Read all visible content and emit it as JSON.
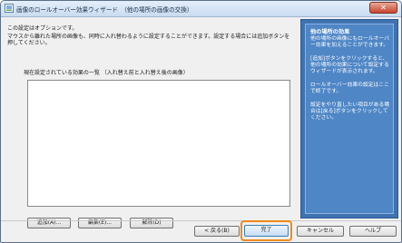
{
  "window": {
    "title": "画像のロールオーバー効果ウィザード　（他の場所の画像の交換）",
    "close_label": "✕"
  },
  "main": {
    "optional_note": "この設定はオプションです。",
    "description": "マウスから離れた場所の画像も、同時に入れ替わるように設定することができます。設定する場合には追加ボタンを押してください。",
    "list_label": "現在設定されている効果の一覧 （入れ替え前と入れ替え後の画像）",
    "effect_list_items": [],
    "add_button": "追加(A)...",
    "edit_button": "編集(E)...",
    "delete_button": "解除(D)"
  },
  "side_panel": {
    "heading": "他の場所の効果",
    "p1": "他の場所の画像にもロールオーバー効果を加えることができます。",
    "p2": "[追加]ボタンをクリックすると、他の場所の効果について設定するウィザードが表示されます。",
    "p3": "ロールオーバー効果の設定はここで終了です。",
    "p4": "設定をやり直したい項目がある場合は[戻る]ボタンをクリックしてください。"
  },
  "footer": {
    "back_button": "< 戻る(B)",
    "finish_button": "完了",
    "cancel_button": "キャンセル",
    "help_button": "ヘルプ"
  },
  "colors": {
    "side_panel_bg": "#4f86c6",
    "highlight_ring": "#f08a1c"
  }
}
